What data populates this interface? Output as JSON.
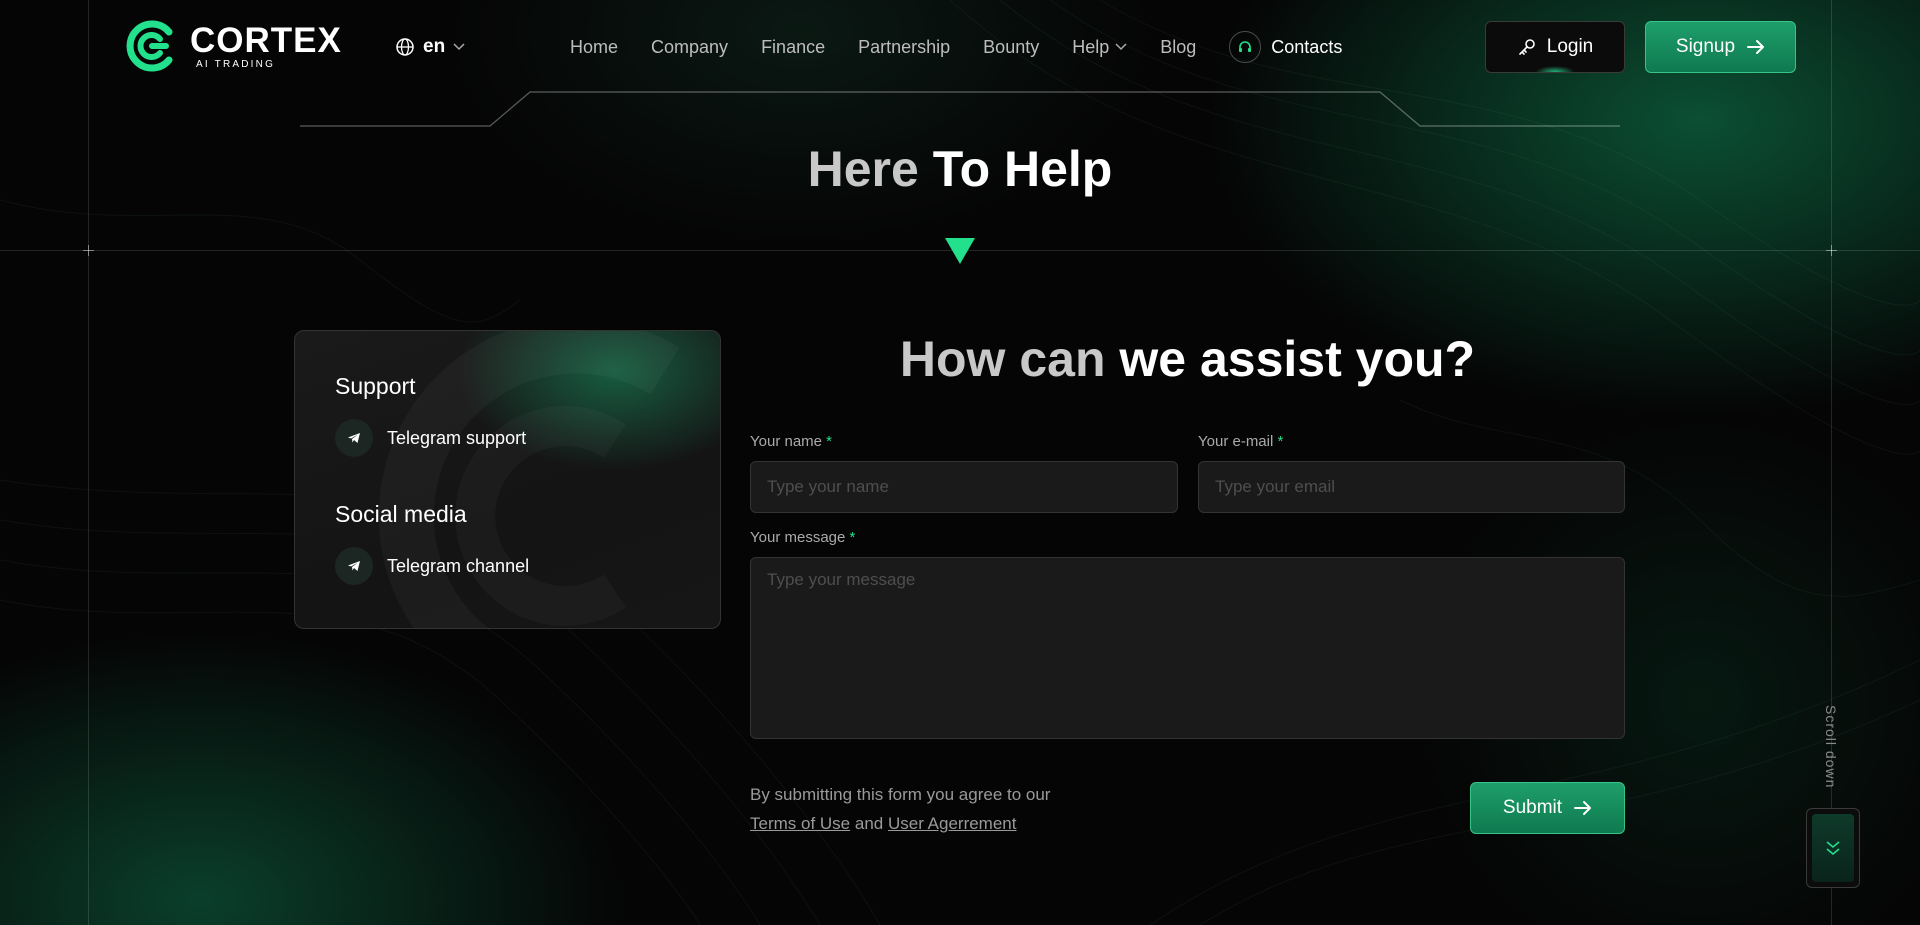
{
  "brand": {
    "name": "CORTEX",
    "tagline": "AI TRADING",
    "accent": "#22e08c"
  },
  "language": {
    "current": "en",
    "icon": "globe-icon"
  },
  "nav": {
    "home": "Home",
    "company": "Company",
    "finance": "Finance",
    "partnership": "Partnership",
    "bounty": "Bounty",
    "help": "Help",
    "blog": "Blog",
    "contacts": "Contacts"
  },
  "auth": {
    "login": "Login",
    "signup": "Signup"
  },
  "hero": {
    "title_dim": "Here",
    "title_bright": "To Help"
  },
  "card": {
    "support_title": "Support",
    "support_link": "Telegram support",
    "social_title": "Social media",
    "social_link": "Telegram channel"
  },
  "form": {
    "title_dim": "How can",
    "title_bright": "we assist you?",
    "name_label": "Your name",
    "name_placeholder": "Type your name",
    "email_label": "Your e-mail",
    "email_placeholder": "Type your email",
    "message_label": "Your message",
    "message_placeholder": "Type your message",
    "required_mark": "*",
    "agree_text": "By submitting this form you agree to our",
    "terms_link": "Terms of Use",
    "and_text": "and",
    "agreement_link": "User Agerrement",
    "submit": "Submit"
  },
  "scroll": {
    "label": "Scroll down"
  }
}
